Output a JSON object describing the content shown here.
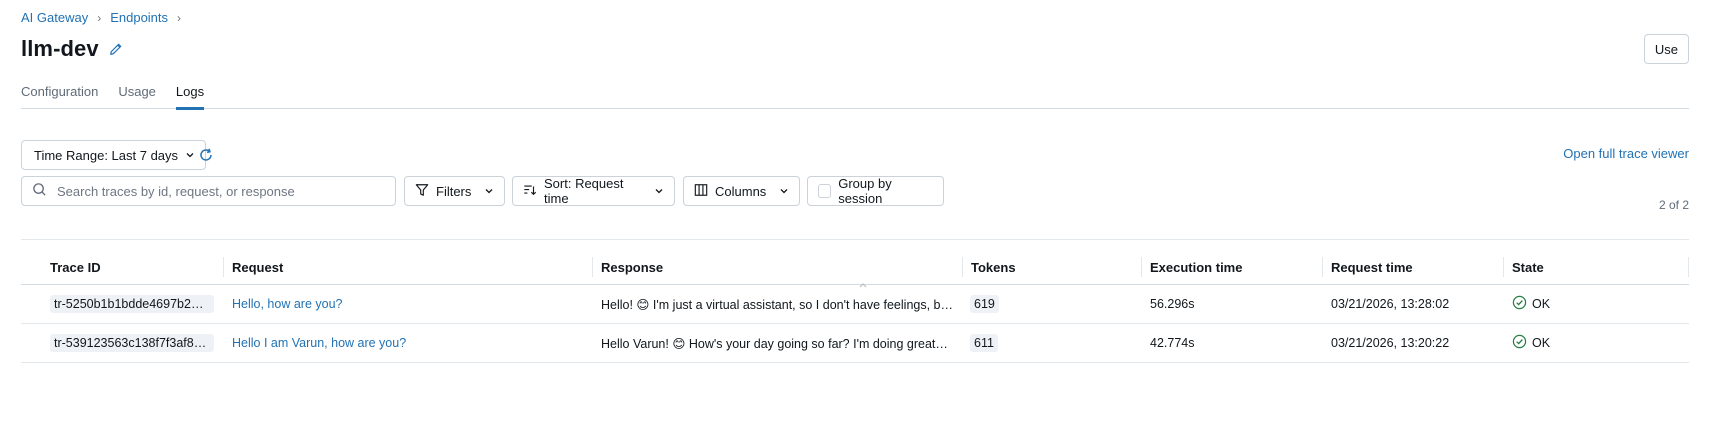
{
  "breadcrumb": [
    {
      "label": "AI Gateway"
    },
    {
      "label": "Endpoints"
    }
  ],
  "page": {
    "title": "llm-dev",
    "use_label": "Use"
  },
  "tabs": [
    {
      "label": "Configuration",
      "active": false
    },
    {
      "label": "Usage",
      "active": false
    },
    {
      "label": "Logs",
      "active": true
    }
  ],
  "toolbar": {
    "time_range_label": "Time Range: Last 7 days",
    "open_trace_viewer": "Open full trace viewer",
    "search_placeholder": "Search traces by id, request, or response",
    "filters_label": "Filters",
    "sort_label": "Sort: Request time",
    "columns_label": "Columns",
    "group_label": "Group by session",
    "count_text": "2 of 2"
  },
  "table": {
    "columns": [
      "Trace ID",
      "Request",
      "Response",
      "Tokens",
      "Execution time",
      "Request time",
      "State"
    ],
    "rows": [
      {
        "trace_id": "tr-5250b1b1bdde4697b2db...",
        "request": "Hello, how are you?",
        "response": "Hello! 😊 I'm just a virtual assistant, so I don't have feelings, but...",
        "tokens": "619",
        "execution_time": "56.296s",
        "request_time": "03/21/2026, 13:28:02",
        "state": "OK"
      },
      {
        "trace_id": "tr-539123563c138f7f3af8e5...",
        "request": "Hello I am Varun, how are you?",
        "response": "Hello Varun! 😊 How's your day going so far? I'm doing great—...",
        "tokens": "611",
        "execution_time": "42.774s",
        "request_time": "03/21/2026, 13:20:22",
        "state": "OK"
      }
    ]
  },
  "colors": {
    "accent": "#2272b4",
    "ok": "#277c43",
    "border": "#cbd2d9"
  },
  "icons": {
    "edit": "pencil-icon",
    "refresh": "refresh-icon",
    "search": "search-icon",
    "filter": "filter-icon",
    "sort": "sort-icon",
    "columns": "columns-icon",
    "state_ok": "check-circle-icon"
  }
}
